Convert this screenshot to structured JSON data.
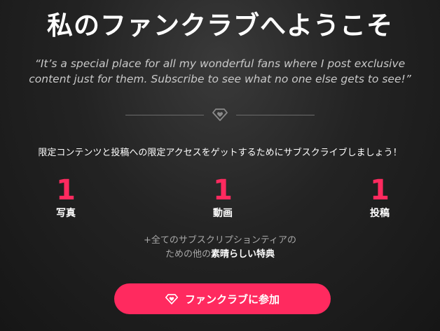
{
  "page": {
    "title": "私のファンクラブへようこそ",
    "quote": "“It’s a special place for all my wonderful fans where I post exclusive content just for them. Subscribe to see what no one else gets to see!”",
    "subtitle": "限定コンテンツと投稿への限定アクセスをゲットするためにサブスクライブしましょう！"
  },
  "stats": [
    {
      "value": "1",
      "label": "写真"
    },
    {
      "value": "1",
      "label": "動画"
    },
    {
      "value": "1",
      "label": "投稿"
    }
  ],
  "perks": {
    "line1": "+全てのサブスクリプションティアの",
    "line2_prefix": "ための他の",
    "line2_highlight": "素晴らしい特典"
  },
  "join_button": {
    "label": "ファンクラブに参加",
    "icon": "diamond-heart-icon"
  },
  "divider": {
    "icon": "diamond-heart-icon"
  },
  "colors": {
    "accent": "#ff2a5f",
    "background": "#1c1c1c",
    "muted": "#a8a8a8"
  }
}
